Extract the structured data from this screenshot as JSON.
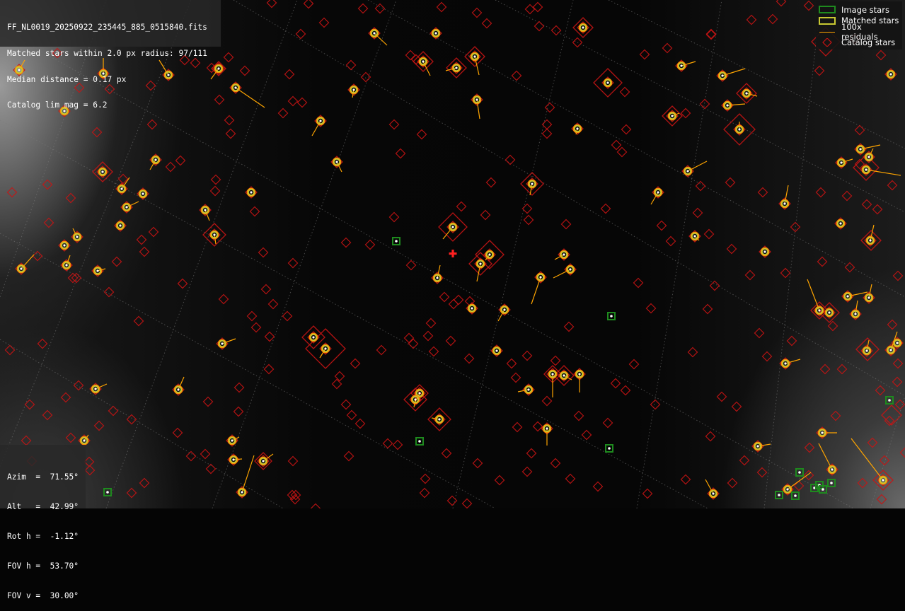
{
  "info": {
    "filename": "FF_NL0019_20250922_235445_885_0515840.fits",
    "matched_line": "Matched stars within 2.0 px radius: 97/111",
    "median_line": "Median distance = 0.17 px",
    "limmag_line": "Catalog lim mag = 6.2"
  },
  "legend": {
    "image_stars": "Image stars",
    "matched_stars": "Matched stars",
    "residuals": "100x residuals",
    "catalog_stars": "Catalog stars",
    "colors": {
      "image": "#1e8a1e",
      "matched": "#c8c832",
      "residual": "#ffa500",
      "catalog": "#c81414"
    }
  },
  "pointing": {
    "azim": "Azim  =  71.55°",
    "alt": "Alt   =  42.99°",
    "roth": "Rot h =  -1.12°",
    "fovh": "FOV h =  53.70°",
    "fovv": "FOV v =  30.00°"
  },
  "center_marker": "red-cross-icon",
  "matched_star_count": 97,
  "total_star_count": 111
}
